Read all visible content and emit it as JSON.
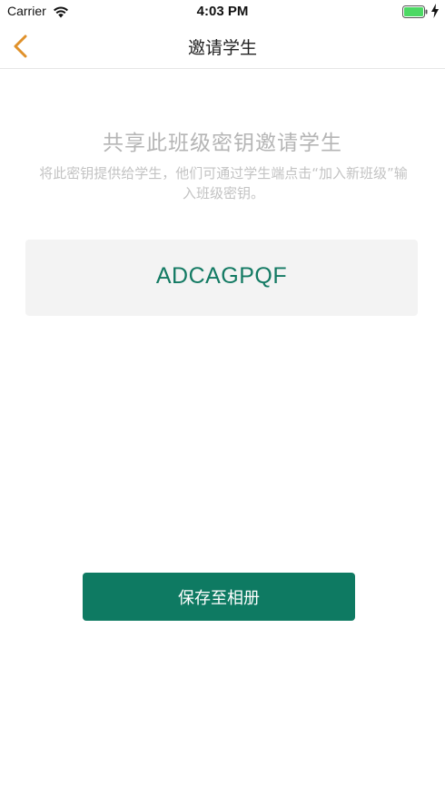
{
  "status_bar": {
    "carrier": "Carrier",
    "time": "4:03 PM",
    "wifi_icon": "wifi-icon",
    "battery_icon": "battery-full-icon",
    "charging_icon": "lightning-icon",
    "battery_color": "#4cd964"
  },
  "nav": {
    "title": "邀请学生",
    "back_icon": "chevron-left-icon",
    "accent_color": "#e0912a"
  },
  "content": {
    "headline": "共享此班级密钥邀请学生",
    "description": "将此密钥提供给学生，他们可通过学生端点击“加入新班级”输入班级密钥。",
    "class_key": "ADCAGPQF",
    "key_color": "#137a63"
  },
  "actions": {
    "save_label": "保存至相册",
    "button_color": "#0e7a62"
  }
}
